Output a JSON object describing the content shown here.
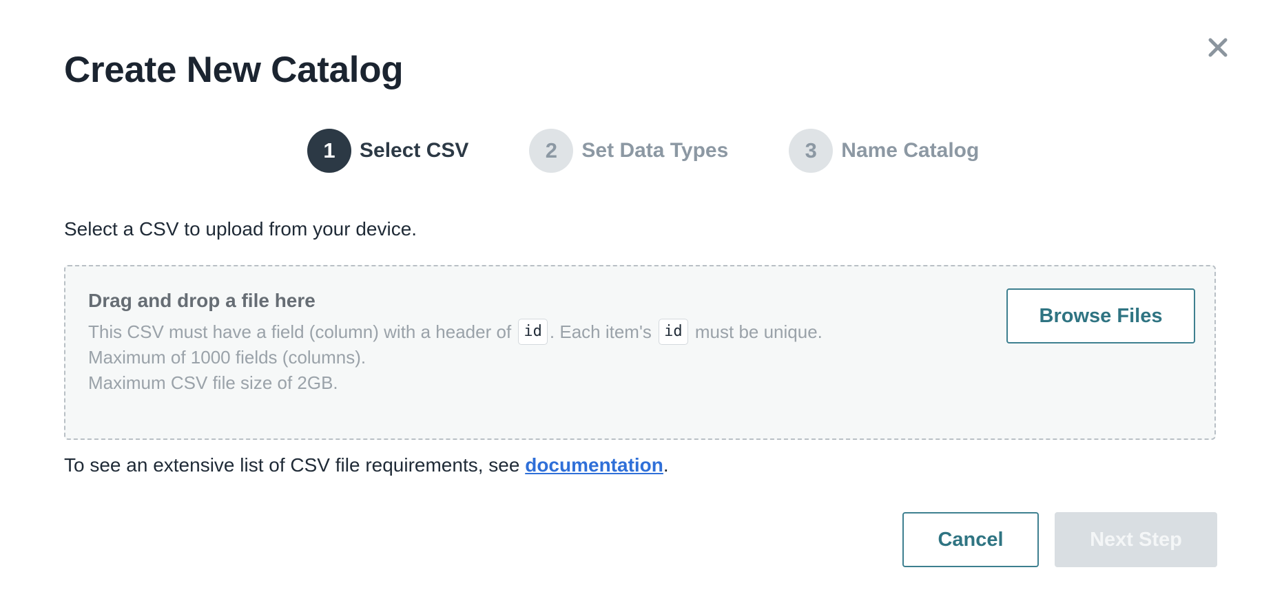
{
  "dialog": {
    "title": "Create New Catalog",
    "close_icon": "close-icon"
  },
  "steps": [
    {
      "number": "1",
      "label": "Select CSV",
      "state": "active"
    },
    {
      "number": "2",
      "label": "Set Data Types",
      "state": "inactive"
    },
    {
      "number": "3",
      "label": "Name Catalog",
      "state": "inactive"
    }
  ],
  "instruction": "Select a CSV to upload from your device.",
  "dropzone": {
    "heading": "Drag and drop a file here",
    "line1_part1": "This CSV must have a field (column) with a header of",
    "line1_code1": "id",
    "line1_part2": ". Each item's",
    "line1_code2": "id",
    "line1_part3": "must be unique.",
    "line2": "Maximum of 1000 fields (columns).",
    "line3": "Maximum CSV file size of 2GB.",
    "browse_label": "Browse Files"
  },
  "requirements": {
    "prefix": "To see an extensive list of CSV file requirements, see ",
    "link": "documentation",
    "suffix": "."
  },
  "footer": {
    "cancel_label": "Cancel",
    "next_label": "Next Step",
    "next_disabled": true
  },
  "colors": {
    "accent": "#2f7482",
    "active_step": "#2c3945",
    "inactive_step": "#dfe3e6",
    "link": "#2f6fd8",
    "disabled_button": "#d9dee2"
  }
}
